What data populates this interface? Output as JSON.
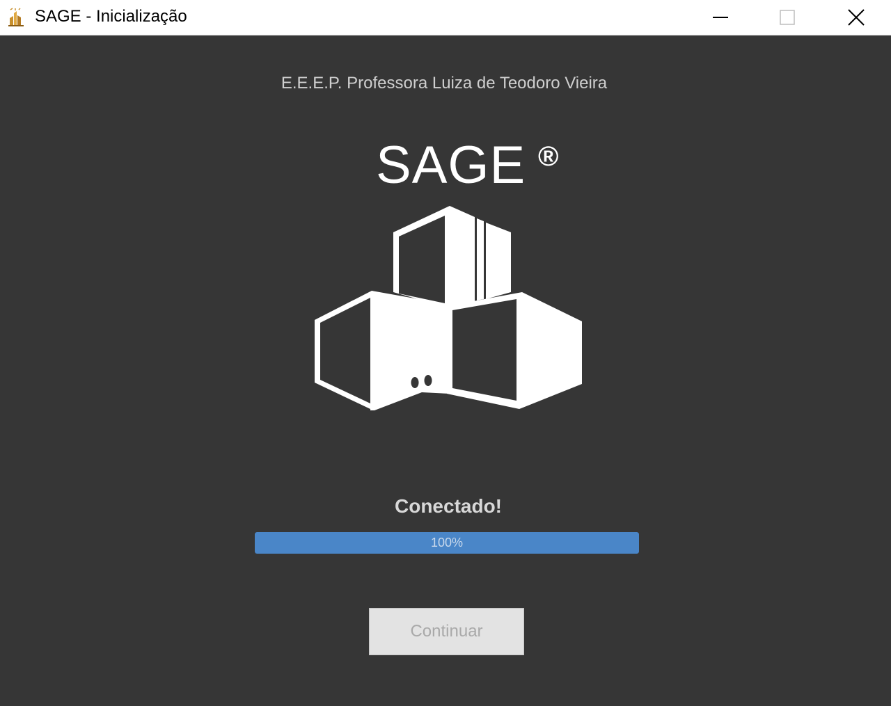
{
  "window": {
    "title": "SAGE - Inicialização",
    "controls": {
      "minimize": "minimize-icon",
      "maximize": "maximize-icon",
      "close": "close-icon"
    }
  },
  "header": {
    "school_name": "E.E.E.P. Professora Luiza de Teodoro Vieira"
  },
  "logo": {
    "text": "SAGE",
    "registered": "®",
    "icon": "building-logo-icon"
  },
  "status": {
    "text": "Conectado!"
  },
  "progress": {
    "value": 100,
    "label": "100%"
  },
  "actions": {
    "continue_label": "Continuar",
    "continue_enabled": false
  },
  "colors": {
    "background": "#363636",
    "progress_fill": "#4a86c8",
    "text_light": "#cfcfcf"
  }
}
